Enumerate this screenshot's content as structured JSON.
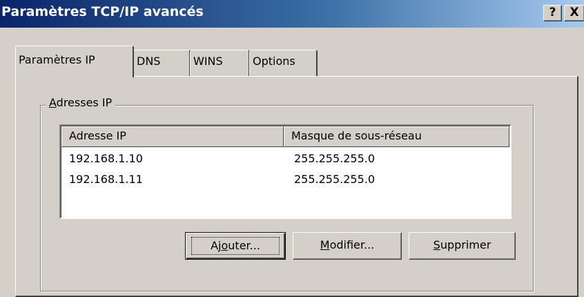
{
  "window": {
    "title": "Paramètres TCP/IP avancés",
    "help_glyph": "?",
    "close_glyph": "X"
  },
  "tabs": [
    {
      "label": "Paramètres IP",
      "active": true
    },
    {
      "label": "DNS",
      "active": false
    },
    {
      "label": "WINS",
      "active": false
    },
    {
      "label": "Options",
      "active": false
    }
  ],
  "ip_group": {
    "label_accel": "A",
    "label_rest": "dresses IP",
    "columns": [
      "Adresse IP",
      "Masque de sous-réseau"
    ],
    "rows": [
      {
        "ip": "192.168.1.10",
        "mask": "255.255.255.0"
      },
      {
        "ip": "192.168.1.11",
        "mask": "255.255.255.0"
      }
    ]
  },
  "buttons": {
    "add": {
      "pre": "Aj",
      "accel": "o",
      "post": "uter..."
    },
    "edit": {
      "accel": "M",
      "post": "odifier..."
    },
    "delete": {
      "accel": "S",
      "post": "upprimer"
    }
  }
}
